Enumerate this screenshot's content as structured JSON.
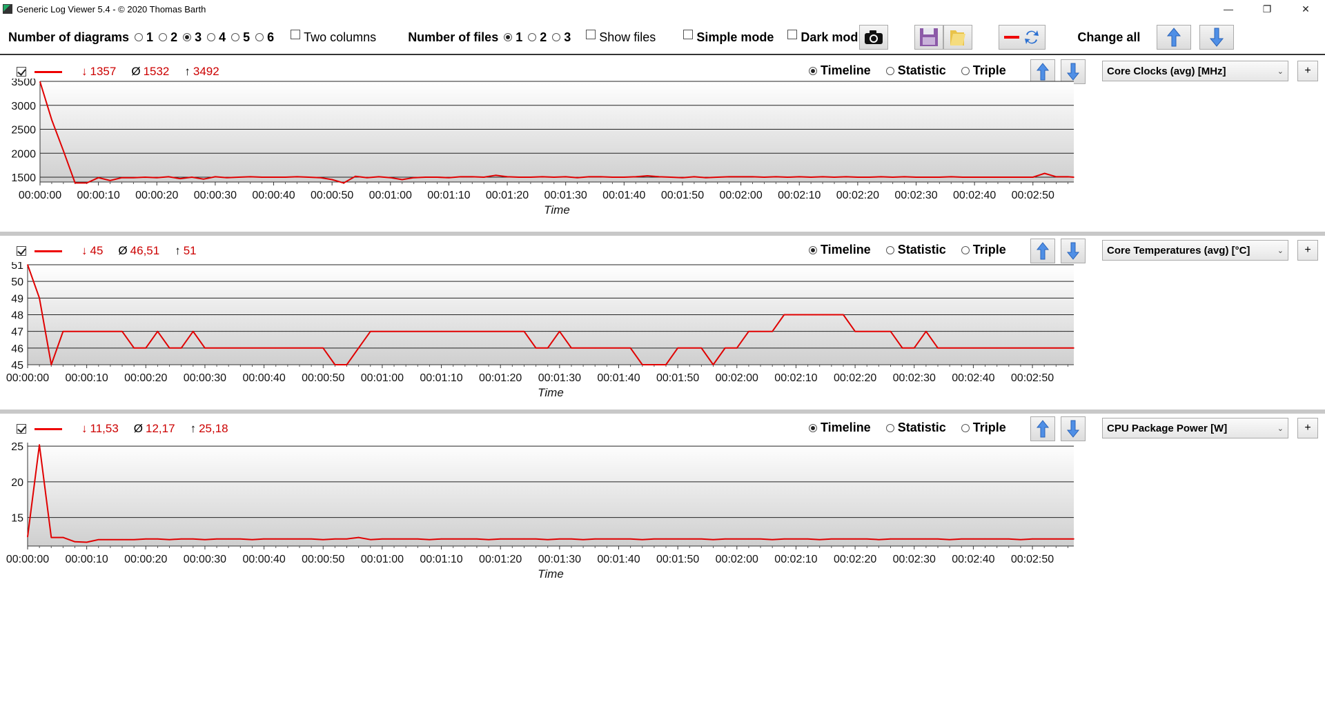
{
  "window": {
    "title": "Generic Log Viewer 5.4 - © 2020 Thomas Barth",
    "minimize": "—",
    "restore": "❐",
    "close": "✕"
  },
  "toolbar": {
    "num_diagrams_label": "Number of diagrams",
    "num_diagrams_options": [
      "1",
      "2",
      "3",
      "4",
      "5",
      "6"
    ],
    "num_diagrams_selected": "3",
    "two_columns_label": "Two columns",
    "two_columns_checked": false,
    "num_files_label": "Number of files",
    "num_files_options": [
      "1",
      "2",
      "3"
    ],
    "num_files_selected": "1",
    "show_files_label": "Show files",
    "show_files_checked": false,
    "simple_mode_label": "Simple mode",
    "simple_mode_checked": false,
    "dark_mode_label": "Dark mod",
    "dark_mode_checked": false,
    "change_all_label": "Change all"
  },
  "view_modes": [
    "Timeline",
    "Statistic",
    "Triple"
  ],
  "time_ticks": [
    "00:00:00",
    "00:00:10",
    "00:00:20",
    "00:00:30",
    "00:00:40",
    "00:00:50",
    "00:01:00",
    "00:01:10",
    "00:01:20",
    "00:01:30",
    "00:01:40",
    "00:01:50",
    "00:02:00",
    "00:02:10",
    "00:02:20",
    "00:02:30",
    "00:02:40",
    "00:02:50"
  ],
  "x_axis_label": "Time",
  "accent_color": "#e00000",
  "panels": [
    {
      "min_symbol": "↓",
      "min": "1357",
      "avg_symbol": "Ø",
      "avg": "1532",
      "max_symbol": "↑",
      "max": "3492",
      "selected_view": "Timeline",
      "sensor": "Core Clocks (avg) [MHz]"
    },
    {
      "min_symbol": "↓",
      "min": "45",
      "avg_symbol": "Ø",
      "avg": "46,51",
      "max_symbol": "↑",
      "max": "51",
      "selected_view": "Timeline",
      "sensor": "Core Temperatures (avg) [°C]"
    },
    {
      "min_symbol": "↓",
      "min": "11,53",
      "avg_symbol": "Ø",
      "avg": "12,17",
      "max_symbol": "↑",
      "max": "25,18",
      "selected_view": "Timeline",
      "sensor": "CPU Package Power [W]"
    }
  ],
  "chart_data": [
    {
      "type": "line",
      "title": "Core Clocks (avg) [MHz]",
      "xlabel": "Time",
      "ylabel": "",
      "x_unit": "seconds",
      "x_range": [
        0,
        177
      ],
      "ylim": [
        1400,
        3500
      ],
      "yticks": [
        1500,
        2000,
        2500,
        3000,
        3500
      ],
      "grid": true,
      "series": [
        {
          "x": [
            0,
            2,
            4,
            6,
            8,
            10,
            12,
            14,
            16,
            18,
            20,
            22,
            24,
            26,
            28,
            30,
            32,
            34,
            36,
            38,
            40,
            42,
            44,
            46,
            48,
            50,
            52,
            54,
            56,
            58,
            60,
            62,
            64,
            66,
            68,
            70,
            72,
            74,
            76,
            78,
            80,
            82,
            84,
            86,
            88,
            90,
            92,
            94,
            96,
            98,
            100,
            102,
            104,
            106,
            108,
            110,
            112,
            114,
            116,
            118,
            120,
            122,
            124,
            126,
            128,
            130,
            132,
            134,
            136,
            138,
            140,
            142,
            144,
            146,
            148,
            150,
            152,
            154,
            156,
            158,
            160,
            162,
            164,
            166,
            168,
            170,
            172,
            174,
            176,
            177
          ],
          "y": [
            3492,
            2700,
            2050,
            1380,
            1380,
            1490,
            1430,
            1490,
            1490,
            1500,
            1490,
            1510,
            1470,
            1500,
            1460,
            1510,
            1490,
            1500,
            1510,
            1500,
            1500,
            1500,
            1510,
            1500,
            1490,
            1450,
            1380,
            1520,
            1490,
            1510,
            1490,
            1450,
            1490,
            1500,
            1500,
            1490,
            1510,
            1510,
            1500,
            1540,
            1510,
            1500,
            1500,
            1510,
            1500,
            1510,
            1490,
            1510,
            1510,
            1500,
            1500,
            1510,
            1530,
            1510,
            1500,
            1490,
            1510,
            1490,
            1500,
            1510,
            1510,
            1510,
            1500,
            1510,
            1500,
            1510,
            1500,
            1510,
            1500,
            1510,
            1500,
            1500,
            1510,
            1500,
            1510,
            1500,
            1500,
            1500,
            1510,
            1500,
            1500,
            1500,
            1500,
            1500,
            1500,
            1500,
            1580,
            1510,
            1510,
            1500
          ]
        }
      ]
    },
    {
      "type": "line",
      "title": "Core Temperatures (avg) [°C]",
      "xlabel": "Time",
      "ylabel": "",
      "x_unit": "seconds",
      "x_range": [
        0,
        177
      ],
      "ylim": [
        45,
        51
      ],
      "yticks": [
        45,
        46,
        47,
        48,
        49,
        50,
        51
      ],
      "grid": true,
      "series": [
        {
          "x": [
            0,
            2,
            4,
            6,
            8,
            10,
            12,
            14,
            16,
            18,
            20,
            22,
            24,
            26,
            28,
            30,
            32,
            34,
            36,
            38,
            40,
            42,
            44,
            46,
            48,
            50,
            52,
            54,
            56,
            58,
            60,
            62,
            64,
            66,
            68,
            70,
            72,
            74,
            76,
            78,
            80,
            82,
            84,
            86,
            88,
            90,
            92,
            94,
            96,
            98,
            100,
            102,
            104,
            106,
            108,
            110,
            112,
            114,
            116,
            118,
            120,
            122,
            124,
            126,
            128,
            130,
            132,
            134,
            136,
            138,
            140,
            142,
            144,
            146,
            148,
            150,
            152,
            154,
            156,
            158,
            160,
            162,
            164,
            166,
            168,
            170,
            172,
            174,
            176,
            177
          ],
          "y": [
            51,
            49,
            45,
            47,
            47,
            47,
            47,
            47,
            47,
            46,
            46,
            47,
            46,
            46,
            47,
            46,
            46,
            46,
            46,
            46,
            46,
            46,
            46,
            46,
            46,
            46,
            45,
            45,
            46,
            47,
            47,
            47,
            47,
            47,
            47,
            47,
            47,
            47,
            47,
            47,
            47,
            47,
            47,
            46,
            46,
            47,
            46,
            46,
            46,
            46,
            46,
            46,
            45,
            45,
            45,
            46,
            46,
            46,
            45,
            46,
            46,
            47,
            47,
            47,
            48,
            48,
            48,
            48,
            48,
            48,
            47,
            47,
            47,
            47,
            46,
            46,
            47,
            46,
            46,
            46,
            46,
            46,
            46,
            46,
            46,
            46,
            46,
            46,
            46,
            46
          ]
        }
      ]
    },
    {
      "type": "line",
      "title": "CPU Package Power [W]",
      "xlabel": "Time",
      "ylabel": "",
      "x_unit": "seconds",
      "x_range": [
        0,
        177
      ],
      "ylim": [
        11,
        25.5
      ],
      "yticks": [
        15,
        20,
        25
      ],
      "grid": true,
      "series": [
        {
          "x": [
            0,
            2,
            4,
            6,
            8,
            10,
            12,
            14,
            16,
            18,
            20,
            22,
            24,
            26,
            28,
            30,
            32,
            34,
            36,
            38,
            40,
            42,
            44,
            46,
            48,
            50,
            52,
            54,
            56,
            58,
            60,
            62,
            64,
            66,
            68,
            70,
            72,
            74,
            76,
            78,
            80,
            82,
            84,
            86,
            88,
            90,
            92,
            94,
            96,
            98,
            100,
            102,
            104,
            106,
            108,
            110,
            112,
            114,
            116,
            118,
            120,
            122,
            124,
            126,
            128,
            130,
            132,
            134,
            136,
            138,
            140,
            142,
            144,
            146,
            148,
            150,
            152,
            154,
            156,
            158,
            160,
            162,
            164,
            166,
            168,
            170,
            172,
            174,
            176,
            177
          ],
          "y": [
            12.3,
            25.18,
            12.2,
            12.2,
            11.6,
            11.53,
            11.9,
            11.9,
            11.9,
            11.9,
            12,
            12,
            11.9,
            12,
            12,
            11.9,
            12,
            12,
            12,
            11.9,
            12,
            12,
            12,
            12,
            12,
            11.9,
            12,
            12,
            12.2,
            11.9,
            12,
            12,
            12,
            12,
            11.9,
            12,
            12,
            12,
            12,
            11.9,
            12,
            12,
            12,
            12,
            11.9,
            12,
            12,
            11.9,
            12,
            12,
            12,
            12,
            11.9,
            12,
            12,
            12,
            12,
            12,
            11.9,
            12,
            12,
            12,
            12,
            11.9,
            12,
            12,
            12,
            11.9,
            12,
            12,
            12,
            12,
            11.9,
            12,
            12,
            12,
            12,
            12,
            11.9,
            12,
            12,
            12,
            12,
            12,
            11.9,
            12,
            12,
            12,
            12,
            12
          ]
        }
      ]
    }
  ]
}
